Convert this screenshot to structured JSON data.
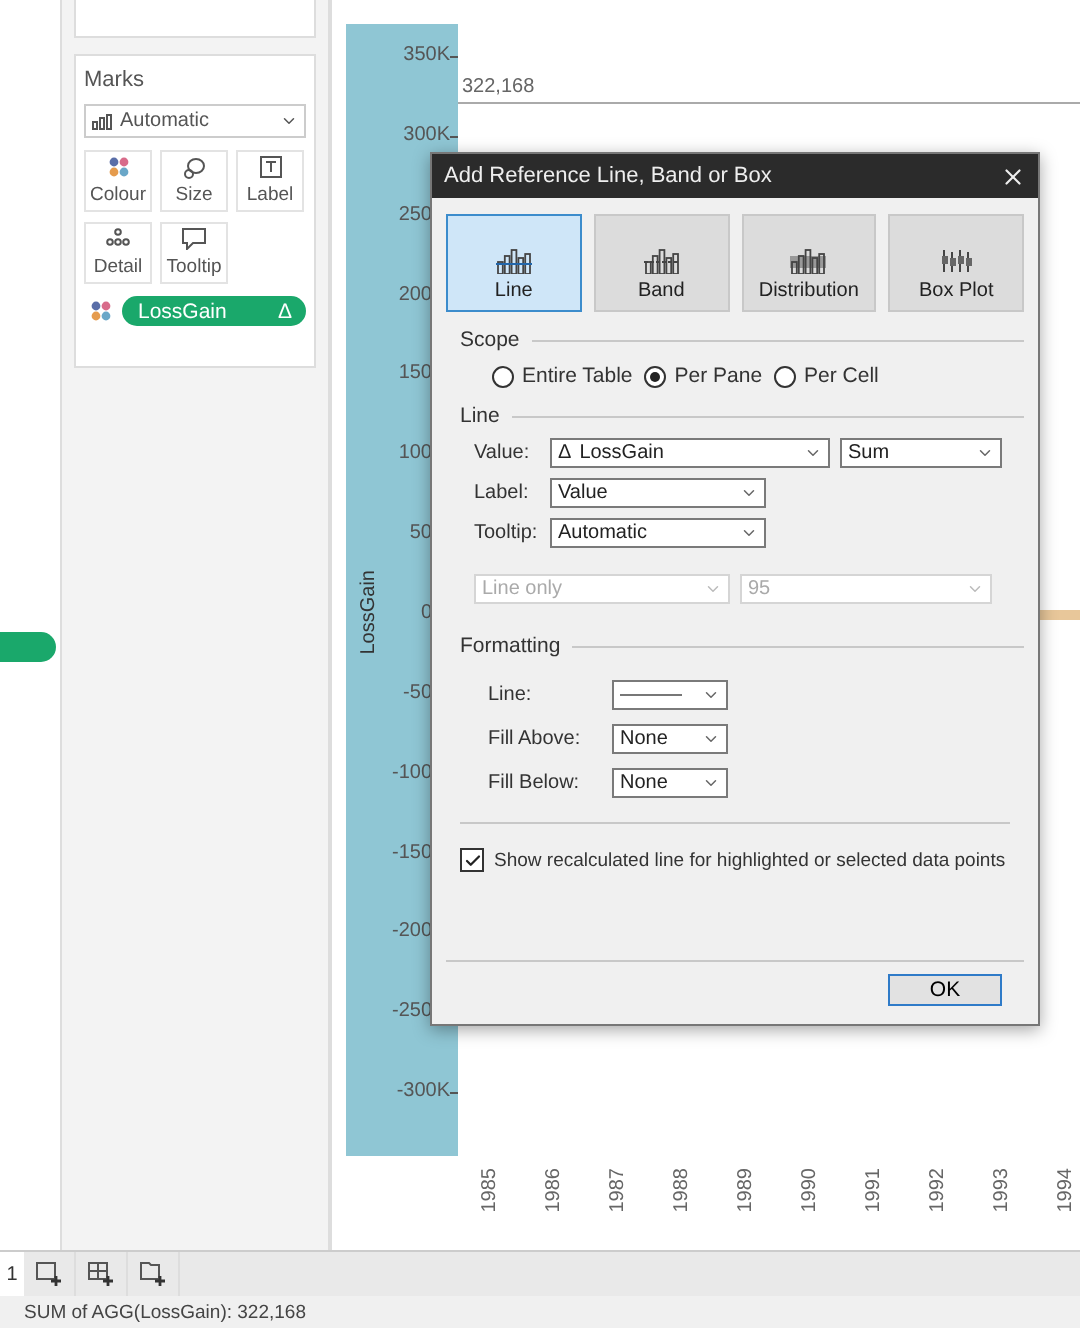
{
  "marks": {
    "title": "Marks",
    "mark_type": "Automatic",
    "cards": [
      {
        "kind": "colour",
        "label": "Colour"
      },
      {
        "kind": "size",
        "label": "Size"
      },
      {
        "kind": "label",
        "label": "Label"
      },
      {
        "kind": "detail",
        "label": "Detail"
      },
      {
        "kind": "tooltip",
        "label": "Tooltip"
      }
    ],
    "field": {
      "label": "LossGain",
      "symbol": "Δ"
    }
  },
  "chart": {
    "axis_title": "LossGain",
    "y_ticks": [
      "350K",
      "300K",
      "250",
      "200",
      "150",
      "100",
      "50",
      "0",
      "-50",
      "-100",
      "-150",
      "-200",
      "-250",
      "-300K"
    ],
    "reference_label": "322,168",
    "years": [
      "1985",
      "1986",
      "1987",
      "1988",
      "1989",
      "1990",
      "1991",
      "1992",
      "1993",
      "1994"
    ]
  },
  "dialog": {
    "title": "Add Reference Line, Band or Box",
    "types": [
      {
        "kind": "line",
        "label": "Line",
        "selected": true
      },
      {
        "kind": "band",
        "label": "Band",
        "selected": false
      },
      {
        "kind": "distribution",
        "label": "Distribution",
        "selected": false
      },
      {
        "kind": "boxplot",
        "label": "Box Plot",
        "selected": false
      }
    ],
    "scope": {
      "title": "Scope",
      "options": [
        {
          "label": "Entire Table",
          "selected": false
        },
        {
          "label": "Per Pane",
          "selected": true
        },
        {
          "label": "Per Cell",
          "selected": false
        }
      ]
    },
    "line": {
      "title": "Line",
      "value": {
        "label": "Value:",
        "symbol": "Δ",
        "field": "LossGain",
        "aggregation": "Sum"
      },
      "label": {
        "label": "Label:",
        "value": "Value"
      },
      "tooltip": {
        "label": "Tooltip:",
        "value": "Automatic"
      },
      "extra": [
        {
          "value": "Line only",
          "disabled": true
        },
        {
          "value": "95",
          "disabled": true
        }
      ]
    },
    "formatting": {
      "title": "Formatting",
      "line_label": "Line:",
      "fills": [
        {
          "label": "Fill Above:",
          "value": "None"
        },
        {
          "label": "Fill Below:",
          "value": "None"
        }
      ]
    },
    "recalculate": {
      "label": "Show recalculated line for highlighted or selected data points",
      "checked": true
    },
    "ok": "OK"
  },
  "sheet_tabs": {
    "current": "1"
  },
  "status": "SUM of AGG(LossGain): 322,168"
}
